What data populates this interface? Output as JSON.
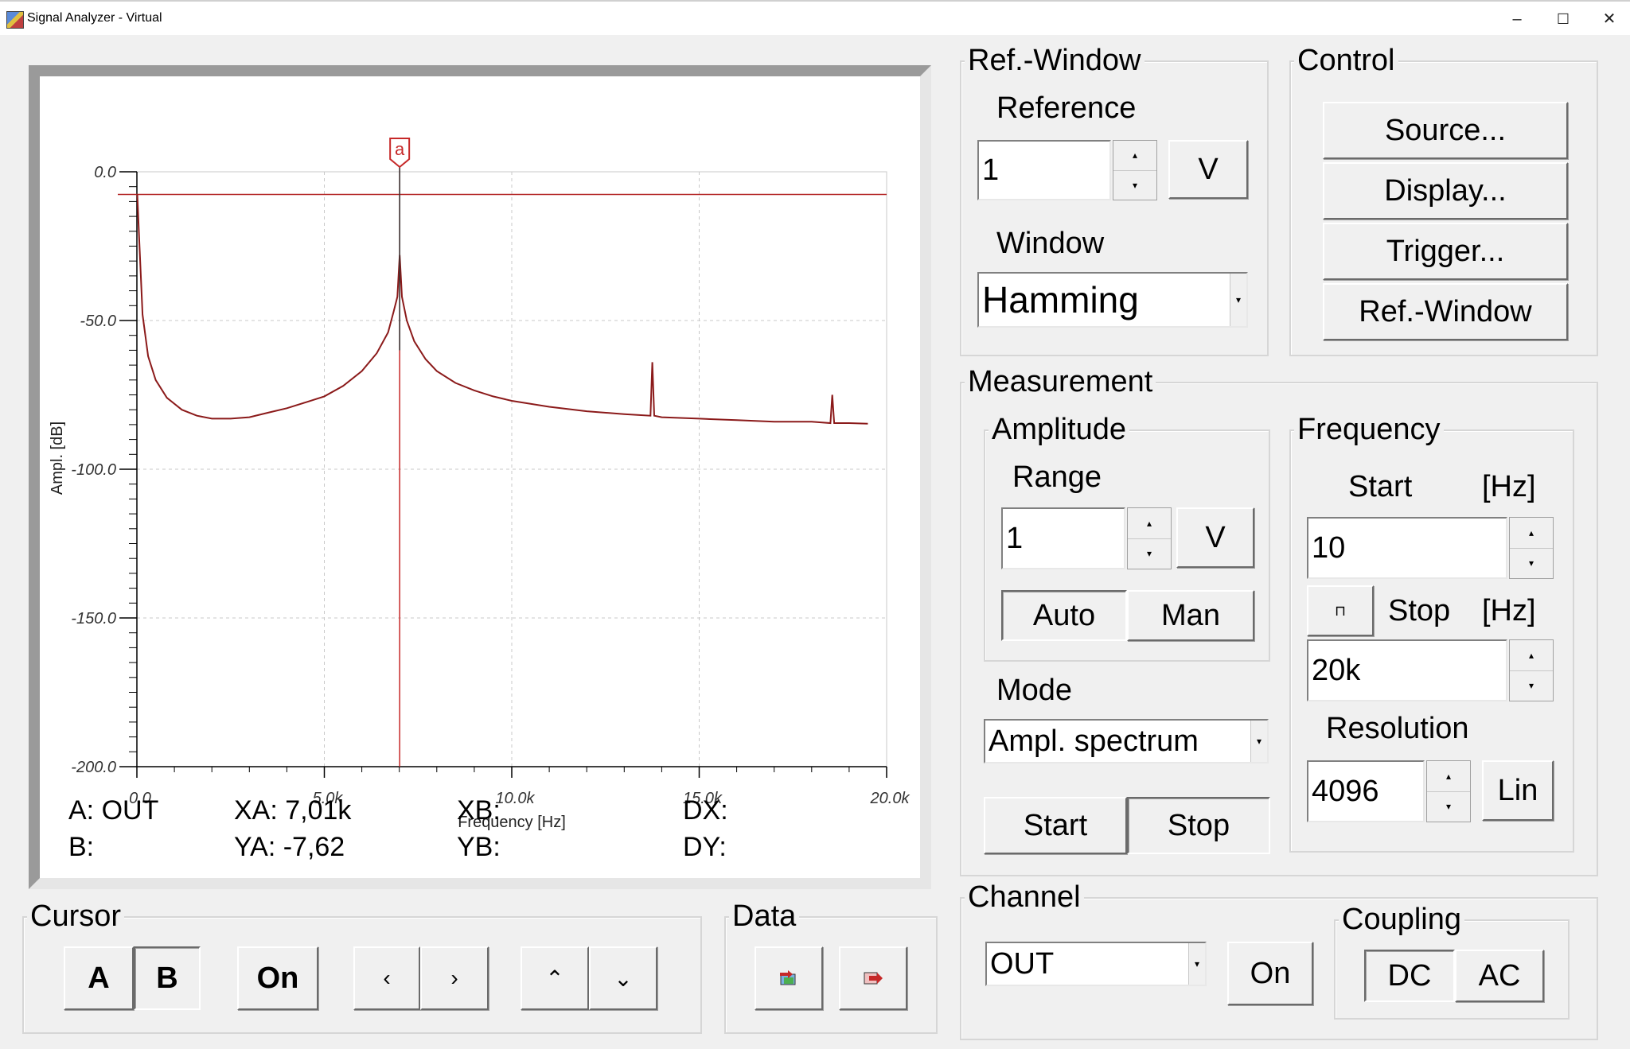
{
  "window": {
    "title": "Signal Analyzer - Virtual",
    "minimize": "–",
    "maximize": "☐",
    "close": "✕"
  },
  "chart_data": {
    "type": "line",
    "title": "",
    "xlabel": "Frequency [Hz]",
    "ylabel": "Ampl. [dB]",
    "xlim": [
      0,
      20000
    ],
    "ylim": [
      -200,
      0
    ],
    "x_ticks": [
      "0.0",
      "5.0k",
      "10.0k",
      "15.0k",
      "20.0k"
    ],
    "y_ticks": [
      "0.0",
      "-50.0",
      "-100.0",
      "-150.0",
      "-200.0"
    ],
    "grid": true,
    "reference_level": -7.62,
    "cursor_a": {
      "label": "a",
      "x": 7010
    },
    "series": [
      {
        "color": "#8b1a1a",
        "x": [
          10,
          60,
          150,
          300,
          500,
          800,
          1200,
          1600,
          2000,
          2500,
          3000,
          3500,
          4000,
          4500,
          5000,
          5500,
          6000,
          6400,
          6700,
          6850,
          6950,
          7010,
          7070,
          7200,
          7400,
          7700,
          8000,
          8500,
          9000,
          9500,
          10000,
          11000,
          12000,
          13000,
          13700,
          13750,
          13800,
          14000,
          15000,
          16000,
          17000,
          18000,
          18500,
          18550,
          18600,
          19000,
          19500
        ],
        "y": [
          -7.6,
          -22,
          -48,
          -62,
          -70,
          -76,
          -80,
          -82,
          -83,
          -83,
          -82.5,
          -81,
          -79.5,
          -77.5,
          -75.5,
          -72,
          -67,
          -61,
          -54,
          -47,
          -42,
          -28,
          -42,
          -50,
          -57,
          -63,
          -67,
          -71,
          -73.5,
          -75.5,
          -77,
          -79,
          -80.5,
          -81.5,
          -82,
          -64,
          -82,
          -82.5,
          -83,
          -83.5,
          -84,
          -84,
          -84.5,
          -75,
          -84.5,
          -84.5,
          -84.7
        ]
      }
    ]
  },
  "readouts": {
    "a_label": "A: OUT",
    "b_label": "B:",
    "xa": "XA: 7,01k",
    "ya": "YA: -7,62",
    "xb": "XB:",
    "yb": "YB:",
    "dx": "DX:",
    "dy": "DY:"
  },
  "cursor": {
    "title": "Cursor",
    "a": "A",
    "b": "B",
    "on": "On",
    "left": "‹",
    "right": "›",
    "up": "⌃",
    "down": "⌄"
  },
  "data": {
    "title": "Data",
    "import_icon": "import-icon",
    "export_icon": "export-icon"
  },
  "ref_window": {
    "title": "Ref.-Window",
    "reference_label": "Reference",
    "reference_value": "1",
    "unit": "V",
    "window_label": "Window",
    "window_value": "Hamming"
  },
  "control": {
    "title": "Control",
    "source": "Source...",
    "display": "Display...",
    "trigger": "Trigger...",
    "refwindow": "Ref.-Window"
  },
  "measurement": {
    "title": "Measurement",
    "amplitude": {
      "title": "Amplitude",
      "range_label": "Range",
      "range_value": "1",
      "unit": "V",
      "auto": "Auto",
      "man": "Man"
    },
    "mode_label": "Mode",
    "mode_value": "Ampl. spectrum",
    "start": "Start",
    "stop": "Stop",
    "frequency": {
      "title": "Frequency",
      "start_label": "Start",
      "unit_hz": "[Hz]",
      "start_value": "10",
      "stop_label": "Stop",
      "stop_value": "20k",
      "resolution_label": "Resolution",
      "resolution_value": "4096",
      "lin": "Lin"
    }
  },
  "channel": {
    "title": "Channel",
    "value": "OUT",
    "on": "On"
  },
  "coupling": {
    "title": "Coupling",
    "dc": "DC",
    "ac": "AC"
  }
}
